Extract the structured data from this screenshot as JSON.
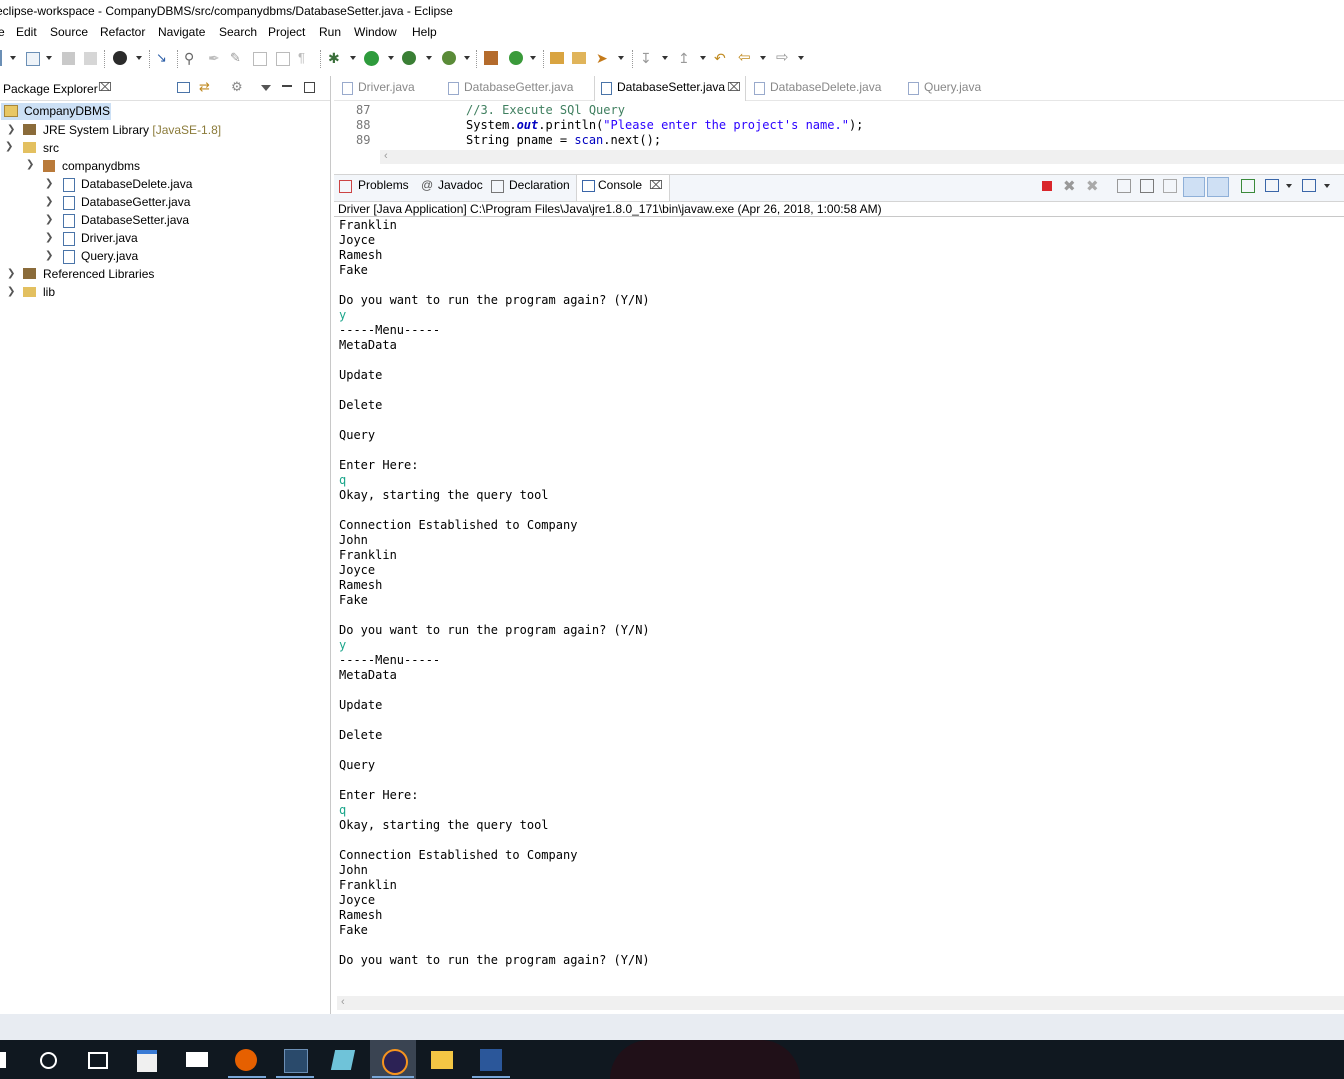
{
  "window": {
    "title": "eclipse-workspace - CompanyDBMS/src/companydbms/DatabaseSetter.java - Eclipse"
  },
  "menu": [
    "e",
    "Edit",
    "Source",
    "Refactor",
    "Navigate",
    "Search",
    "Project",
    "Run",
    "Window",
    "Help"
  ],
  "package_explorer": {
    "title": "Package Explorer",
    "tree": [
      {
        "label": "CompanyDBMS",
        "level": 0,
        "selected": true
      },
      {
        "label": "JRE System Library",
        "suffix": "[JavaSE-1.8]",
        "level": 1
      },
      {
        "label": "src",
        "level": 1
      },
      {
        "label": "companydbms",
        "level": 2
      },
      {
        "label": "DatabaseDelete.java",
        "level": 3
      },
      {
        "label": "DatabaseGetter.java",
        "level": 3
      },
      {
        "label": "DatabaseSetter.java",
        "level": 3
      },
      {
        "label": "Driver.java",
        "level": 3
      },
      {
        "label": "Query.java",
        "level": 3
      },
      {
        "label": "Referenced Libraries",
        "level": 1
      },
      {
        "label": "lib",
        "level": 1
      }
    ]
  },
  "editor": {
    "tabs": [
      "Driver.java",
      "DatabaseGetter.java",
      "DatabaseSetter.java",
      "DatabaseDelete.java",
      "Query.java"
    ],
    "active_tab": "DatabaseSetter.java",
    "lines": [
      {
        "num": "87",
        "comment": "//3. Execute SQl Query"
      },
      {
        "num": "88",
        "pre": "System.",
        "field": "out",
        "mid": ".println(",
        "str": "\"Please enter the project's name.\"",
        "post": ");"
      },
      {
        "num": "89",
        "pre": "String pname = ",
        "var": "scan",
        "post": ".next();"
      }
    ]
  },
  "console": {
    "tabs": [
      "Problems",
      "Javadoc",
      "Declaration",
      "Console"
    ],
    "active_tab": "Console",
    "launch": "Driver [Java Application] C:\\Program Files\\Java\\jre1.8.0_171\\bin\\javaw.exe (Apr 26, 2018, 1:00:58 AM)",
    "output": [
      "Franklin",
      "Joyce",
      "Ramesh",
      "Fake",
      "",
      "Do you want to run the program again? (Y/N)",
      {
        "input": "y"
      },
      "-----Menu-----",
      "MetaData",
      "",
      "Update",
      "",
      "Delete",
      "",
      "Query",
      "",
      "Enter Here:",
      {
        "input": "q"
      },
      "Okay, starting the query tool",
      "",
      "Connection Established to Company",
      "John",
      "Franklin",
      "Joyce",
      "Ramesh",
      "Fake",
      "",
      "Do you want to run the program again? (Y/N)",
      {
        "input": "y"
      },
      "-----Menu-----",
      "MetaData",
      "",
      "Update",
      "",
      "Delete",
      "",
      "Query",
      "",
      "Enter Here:",
      {
        "input": "q"
      },
      "Okay, starting the query tool",
      "",
      "Connection Established to Company",
      "John",
      "Franklin",
      "Joyce",
      "Ramesh",
      "Fake",
      "",
      "Do you want to run the program again? (Y/N)"
    ]
  },
  "taskbar": [
    "windows-start",
    "cortana",
    "task-view",
    "store",
    "mail",
    "firefox",
    "mysql-workbench",
    "notepad",
    "eclipse",
    "file-explorer",
    "word"
  ]
}
